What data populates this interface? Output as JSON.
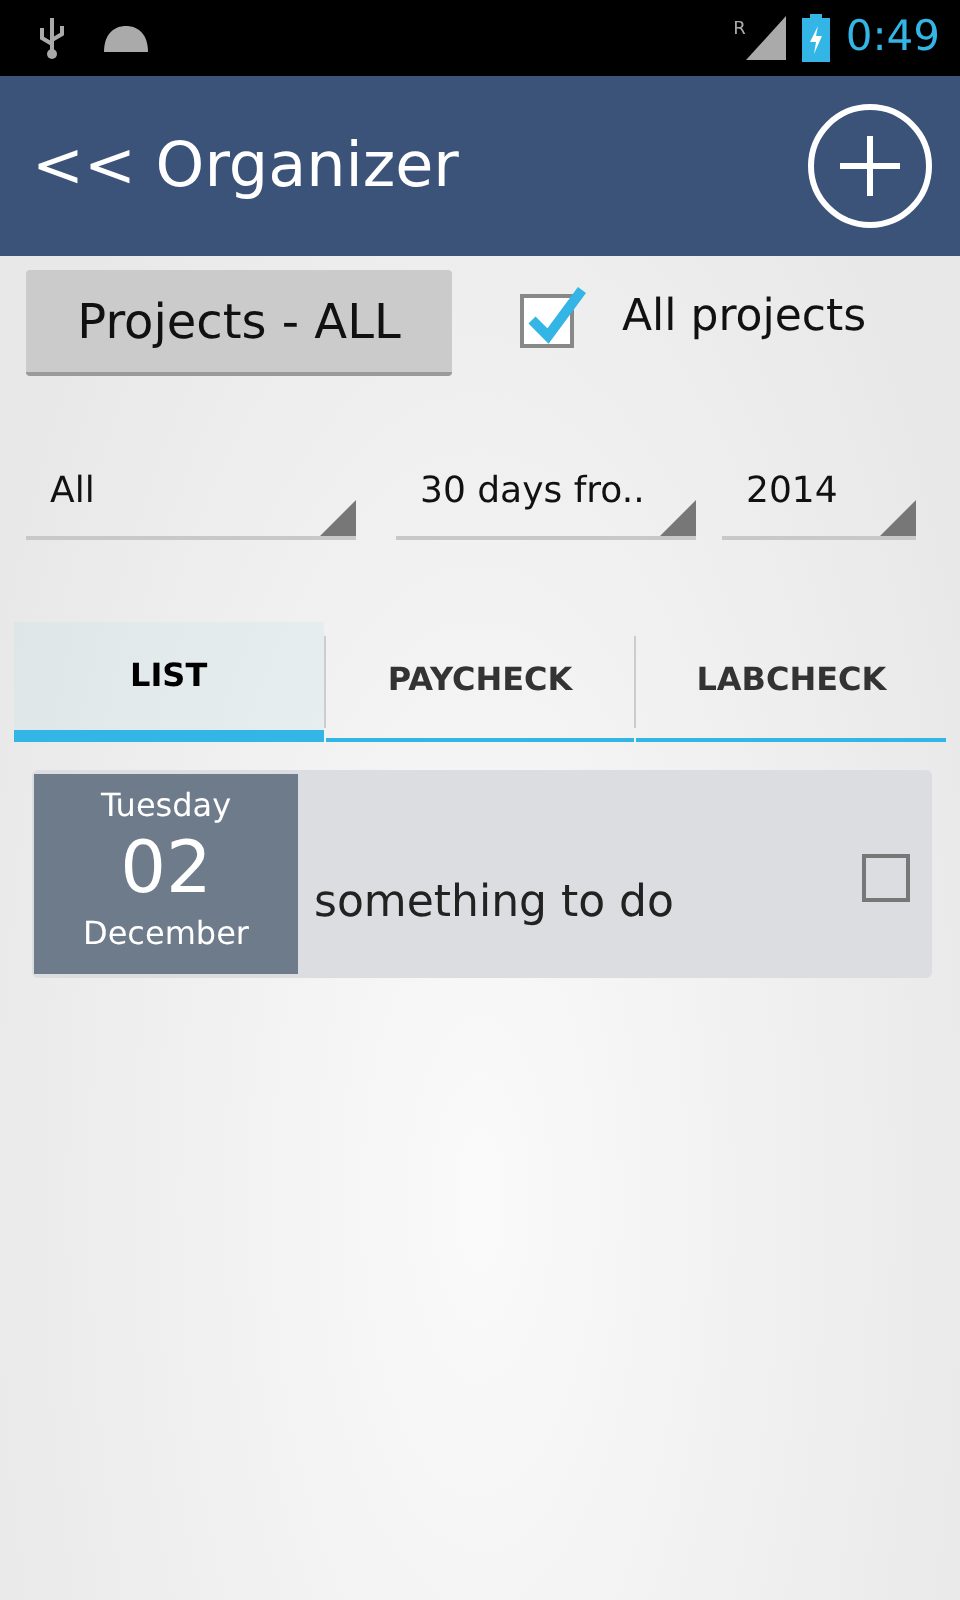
{
  "status_bar": {
    "time": "0:49",
    "network_label": "R"
  },
  "action_bar": {
    "title": "<< Organizer"
  },
  "projects_button": {
    "label": "Projects - ALL"
  },
  "all_projects": {
    "label": "All projects",
    "checked": true
  },
  "spinners": [
    {
      "value": "All"
    },
    {
      "value": "30 days fro.."
    },
    {
      "value": "2014"
    }
  ],
  "tabs": [
    {
      "label": "LIST",
      "selected": true
    },
    {
      "label": "PAYCHECK",
      "selected": false
    },
    {
      "label": "LABCHECK",
      "selected": false
    }
  ],
  "items": [
    {
      "weekday": "Tuesday",
      "day": "02",
      "month": "December",
      "text": "something to do",
      "checked": false
    }
  ]
}
